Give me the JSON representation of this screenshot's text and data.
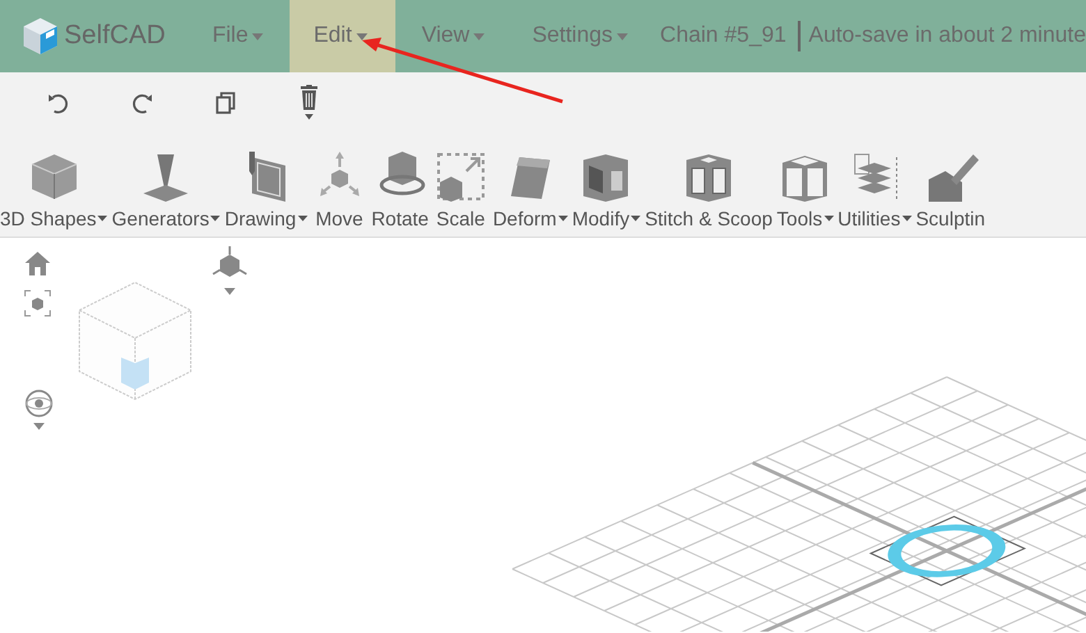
{
  "app": {
    "logo_text": "SelfCAD"
  },
  "menu": [
    {
      "label": "File",
      "selected": false
    },
    {
      "label": "Edit",
      "selected": true
    },
    {
      "label": "View",
      "selected": false
    },
    {
      "label": "Settings",
      "selected": false
    }
  ],
  "project": {
    "name": "Chain #5_91",
    "autosave": "Auto-save in about 2 minute"
  },
  "tools": [
    {
      "label": "3D Shapes",
      "dropdown": true
    },
    {
      "label": "Generators",
      "dropdown": true
    },
    {
      "label": "Drawing",
      "dropdown": true
    },
    {
      "label": "Move",
      "dropdown": false
    },
    {
      "label": "Rotate",
      "dropdown": false
    },
    {
      "label": "Scale",
      "dropdown": false
    },
    {
      "label": "Deform",
      "dropdown": true
    },
    {
      "label": "Modify",
      "dropdown": true
    },
    {
      "label": "Stitch & Scoop",
      "dropdown": false
    },
    {
      "label": "Tools",
      "dropdown": true
    },
    {
      "label": "Utilities",
      "dropdown": true
    },
    {
      "label": "Sculptin",
      "dropdown": false
    }
  ]
}
